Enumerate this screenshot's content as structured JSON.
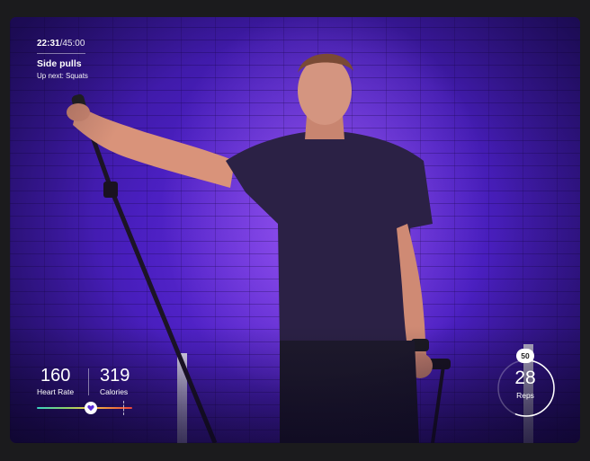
{
  "timer": {
    "elapsed": "22:31",
    "total": "/45:00"
  },
  "exercise": {
    "current": "Side pulls",
    "up_next": "Up next: Squats"
  },
  "stats": {
    "heart_rate": {
      "value": "160",
      "label": "Heart Rate"
    },
    "calories": {
      "value": "319",
      "label": "Calories"
    }
  },
  "heart_rate_zone": {
    "marker_fraction": 0.57,
    "target_fraction": 0.91
  },
  "reps": {
    "count": "28",
    "label": "Reps",
    "target": "50",
    "progress_fraction": 0.56
  },
  "icons": {
    "heart": "heart-icon"
  },
  "colors": {
    "background_accent": "#5a25d6",
    "shirt": "#2a1f45",
    "text": "#ffffff"
  }
}
